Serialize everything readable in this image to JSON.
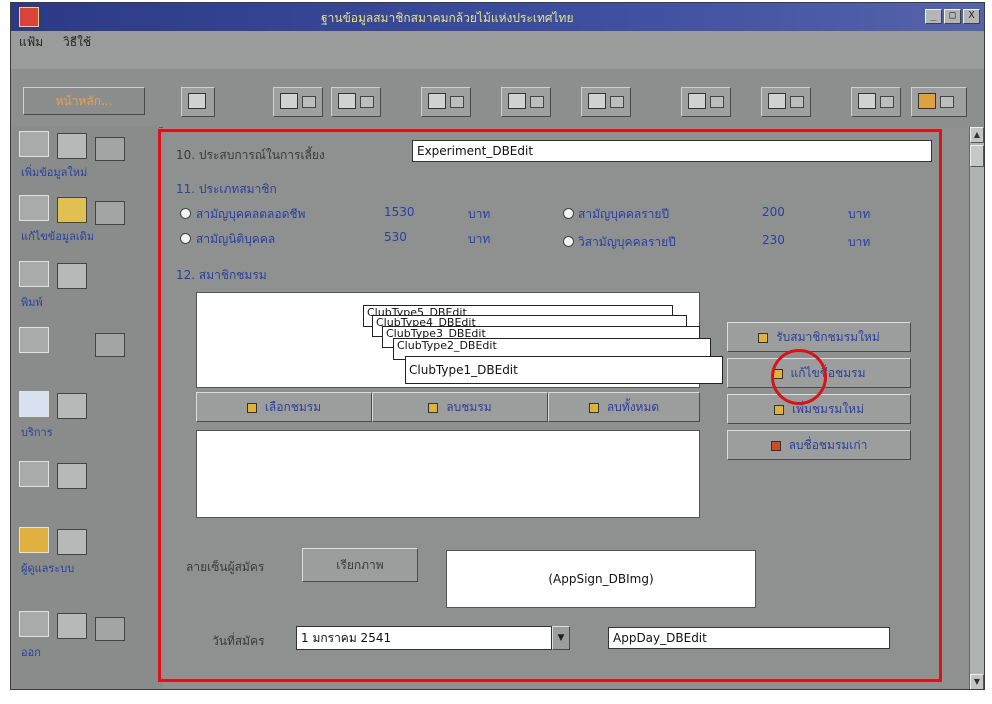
{
  "window": {
    "title": "ฐานข้อมูลสมาชิกสมาคมกล้วยไม้แห่งประเทศไทย",
    "controls": [
      "_",
      "□",
      "X"
    ]
  },
  "menu": {
    "items": [
      "แฟ้ม",
      "วิธีใช้"
    ]
  },
  "toolbar": {
    "primary_label": "หน้าหลัก..."
  },
  "sidebar": {
    "items": [
      {
        "label": "เพิ่มข้อมูลใหม่"
      },
      {
        "label": "แก้ไขข้อมูลเดิม"
      },
      {
        "label": "พิมพ์"
      },
      {
        "label": ""
      },
      {
        "label": "บริการ"
      },
      {
        "label": ""
      },
      {
        "label": "ผู้ดูแลระบบ"
      },
      {
        "label": "ออก"
      }
    ]
  },
  "form": {
    "field10_label": "10. ประสบการณ์ในการเลี้ยง",
    "field10_value": "Experiment_DBEdit",
    "field11_label": "11. ประเภทสมาชิก",
    "options": [
      {
        "name": "สามัญบุคคลตลอดชีพ",
        "amount": "1530",
        "unit": "บาท",
        "selected": false
      },
      {
        "name": "สามัญนิติบุคคล",
        "amount": "530",
        "unit": "บาท",
        "selected": false
      },
      {
        "name": "สามัญบุคคลรายปี",
        "amount": "200",
        "unit": "บาท",
        "selected": false
      },
      {
        "name": "วิสามัญบุคคลรายปี",
        "amount": "230",
        "unit": "บาท",
        "selected": false
      }
    ],
    "field12_label": "12. สมาชิกชมรม",
    "stack_cards": [
      "ClubType5_DBEdit",
      "ClubType4_DBEdit",
      "ClubType3_DBEdit",
      "ClubType2_DBEdit",
      "ClubType1_DBEdit"
    ],
    "left_buttons": [
      "เลือกชมรม",
      "ลบชมรม",
      "ลบทั้งหมด"
    ],
    "right_buttons": [
      "รับสมาชิกชมรมใหม่",
      "แก้ไขชื่อชมรม",
      "เพิ่มชมรมใหม่",
      "ลบชื่อชมรมเก่า"
    ],
    "signature_label": "ลายเซ็นผู้สมัคร",
    "signature_button": "เรียกภาพ",
    "signature_image": "(AppSign_DBImg)",
    "date_label": "วันที่สมัคร",
    "date_value": "1  มกราคม   2541",
    "date_field": "AppDay_DBEdit"
  },
  "colors": {
    "title_bar": "#3e4fa0",
    "highlight_frame": "#d8141a",
    "label_blue": "#2b3fa0"
  }
}
